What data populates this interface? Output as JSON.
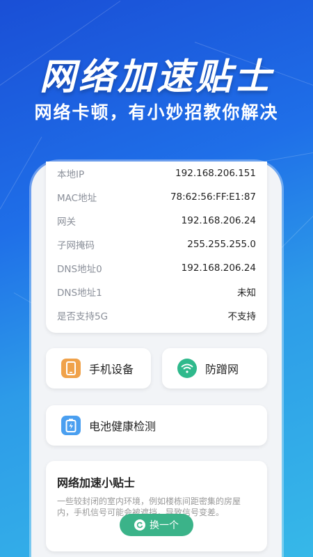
{
  "hero": {
    "title": "网络加速贴士",
    "subtitle": "网络卡顿，有小妙招教你解决"
  },
  "info": {
    "rows": [
      {
        "key": "本地IP",
        "value": "192.168.206.151"
      },
      {
        "key": "MAC地址",
        "value": "78:62:56:FF:E1:87"
      },
      {
        "key": "网关",
        "value": "192.168.206.24"
      },
      {
        "key": "子网掩码",
        "value": "255.255.255.0"
      },
      {
        "key": "DNS地址0",
        "value": "192.168.206.24"
      },
      {
        "key": "DNS地址1",
        "value": "未知"
      },
      {
        "key": "是否支持5G",
        "value": "不支持"
      }
    ]
  },
  "actions": {
    "phone_device": {
      "label": "手机设备",
      "icon": "phone-icon",
      "color": "#f0a24a"
    },
    "anti_leech": {
      "label": "防蹭网",
      "icon": "wifi-icon",
      "color": "#2fb98c"
    },
    "battery": {
      "label": "电池健康检测",
      "icon": "battery-icon",
      "color": "#4a9ff0"
    }
  },
  "tips": {
    "title": "网络加速小贴士",
    "text": "一些较封闭的室内环境，例如楼栋间距密集的房屋内，手机信号可能会被遮挡，导致信号变差。",
    "button_label": "换一个"
  }
}
